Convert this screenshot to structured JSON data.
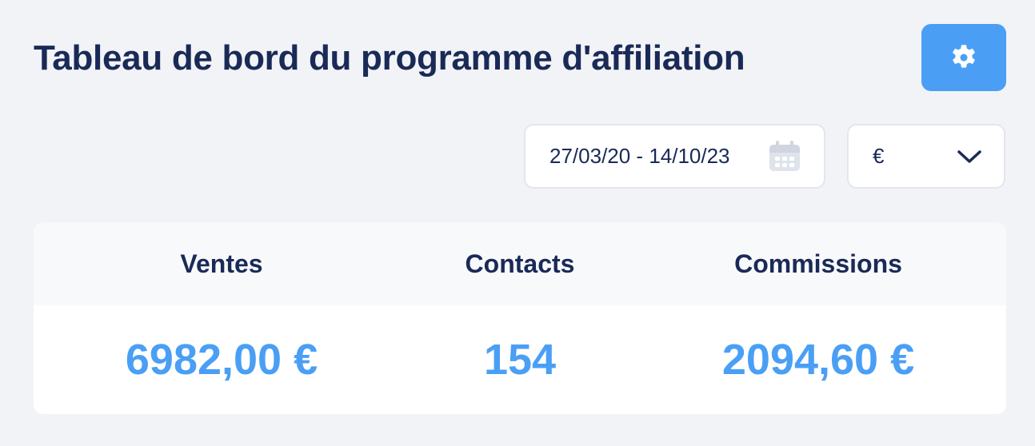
{
  "header": {
    "title": "Tableau de bord du programme d'affiliation",
    "settings_icon": "gear-icon"
  },
  "filters": {
    "date_range": "27/03/20 - 14/10/23",
    "date_icon": "calendar-icon",
    "currency": "€",
    "currency_icon": "chevron-down-icon"
  },
  "stats": {
    "sales": {
      "label": "Ventes",
      "value": "6982,00 €"
    },
    "contacts": {
      "label": "Contacts",
      "value": "154"
    },
    "commissions": {
      "label": "Commissions",
      "value": "2094,60 €"
    }
  },
  "colors": {
    "accent": "#4a9ff5",
    "text_dark": "#1a2a57",
    "background": "#f2f3f7",
    "card": "#ffffff",
    "card_header": "#f8f9fb"
  }
}
